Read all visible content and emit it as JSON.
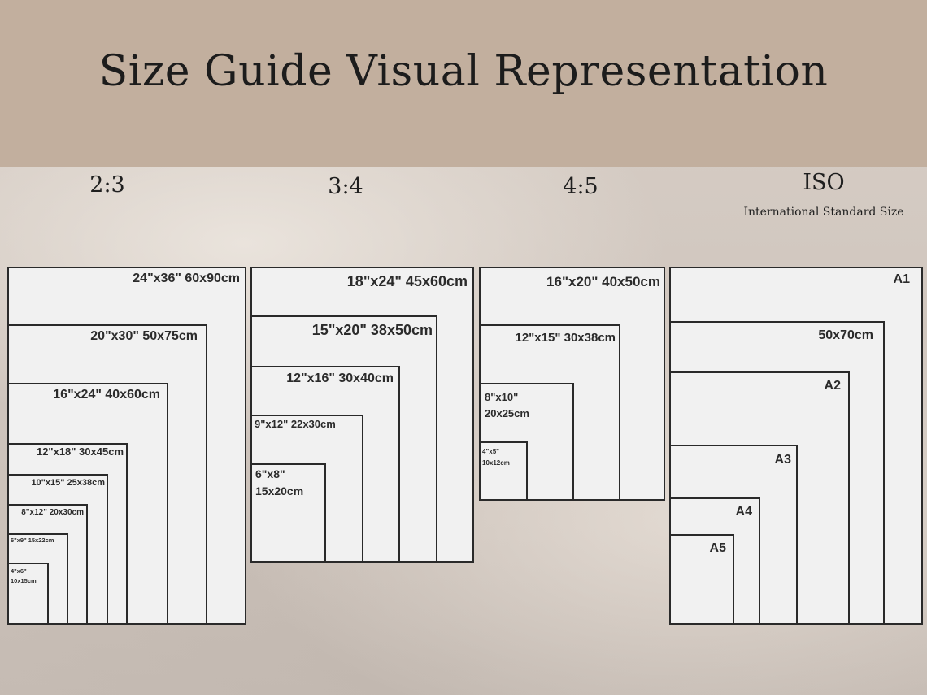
{
  "header": {
    "title": "Size Guide Visual Representation"
  },
  "groups": [
    {
      "ratio": "2:3",
      "sizes": [
        {
          "line1": "24\"x36\"  60x90cm"
        },
        {
          "line1": "20\"x30\"  50x75cm"
        },
        {
          "line1": "16\"x24\"  40x60cm"
        },
        {
          "line1": "12\"x18\"  30x45cm"
        },
        {
          "line1": "10\"x15\"  25x38cm"
        },
        {
          "line1": "8\"x12\"  20x30cm"
        },
        {
          "line1": "6\"x9\" 15x22cm"
        },
        {
          "line1": "4\"x6\"",
          "line2": "10x15cm"
        }
      ]
    },
    {
      "ratio": "3:4",
      "sizes": [
        {
          "line1": "18\"x24\"  45x60cm"
        },
        {
          "line1": "15\"x20\"  38x50cm"
        },
        {
          "line1": "12\"x16\"  30x40cm"
        },
        {
          "line1": "9\"x12\"  22x30cm"
        },
        {
          "line1": "6\"x8\"",
          "line2": "15x20cm"
        }
      ]
    },
    {
      "ratio": "4:5",
      "sizes": [
        {
          "line1": "16\"x20\"  40x50cm"
        },
        {
          "line1": "12\"x15\"  30x38cm"
        },
        {
          "line1": "8\"x10\"",
          "line2": "20x25cm"
        },
        {
          "line1": "4\"x5\"",
          "line2": "10x12cm"
        }
      ]
    },
    {
      "ratio": "ISO",
      "subtitle": "International Standard Size",
      "sizes": [
        {
          "line1": "A1"
        },
        {
          "line1": "50x70cm"
        },
        {
          "line1": "A2"
        },
        {
          "line1": "A3"
        },
        {
          "line1": "A4"
        },
        {
          "line1": "A5"
        }
      ]
    }
  ]
}
